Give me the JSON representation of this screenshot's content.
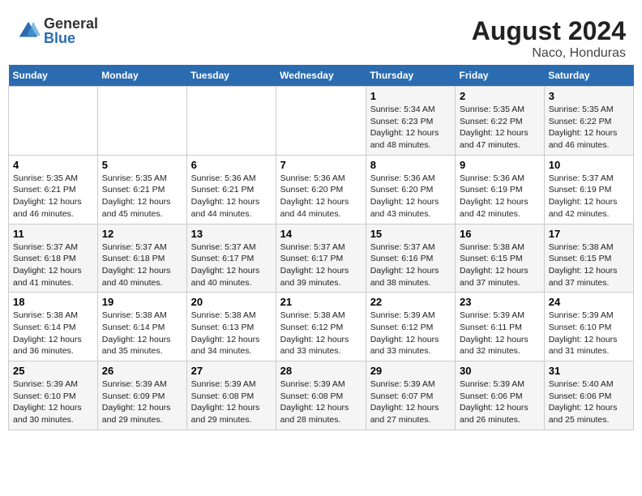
{
  "header": {
    "logo_general": "General",
    "logo_blue": "Blue",
    "title": "August 2024",
    "subtitle": "Naco, Honduras"
  },
  "calendar": {
    "days_of_week": [
      "Sunday",
      "Monday",
      "Tuesday",
      "Wednesday",
      "Thursday",
      "Friday",
      "Saturday"
    ],
    "weeks": [
      [
        {
          "day": "",
          "data": ""
        },
        {
          "day": "",
          "data": ""
        },
        {
          "day": "",
          "data": ""
        },
        {
          "day": "",
          "data": ""
        },
        {
          "day": "1",
          "data": "Sunrise: 5:34 AM\nSunset: 6:23 PM\nDaylight: 12 hours\nand 48 minutes."
        },
        {
          "day": "2",
          "data": "Sunrise: 5:35 AM\nSunset: 6:22 PM\nDaylight: 12 hours\nand 47 minutes."
        },
        {
          "day": "3",
          "data": "Sunrise: 5:35 AM\nSunset: 6:22 PM\nDaylight: 12 hours\nand 46 minutes."
        }
      ],
      [
        {
          "day": "4",
          "data": "Sunrise: 5:35 AM\nSunset: 6:21 PM\nDaylight: 12 hours\nand 46 minutes."
        },
        {
          "day": "5",
          "data": "Sunrise: 5:35 AM\nSunset: 6:21 PM\nDaylight: 12 hours\nand 45 minutes."
        },
        {
          "day": "6",
          "data": "Sunrise: 5:36 AM\nSunset: 6:21 PM\nDaylight: 12 hours\nand 44 minutes."
        },
        {
          "day": "7",
          "data": "Sunrise: 5:36 AM\nSunset: 6:20 PM\nDaylight: 12 hours\nand 44 minutes."
        },
        {
          "day": "8",
          "data": "Sunrise: 5:36 AM\nSunset: 6:20 PM\nDaylight: 12 hours\nand 43 minutes."
        },
        {
          "day": "9",
          "data": "Sunrise: 5:36 AM\nSunset: 6:19 PM\nDaylight: 12 hours\nand 42 minutes."
        },
        {
          "day": "10",
          "data": "Sunrise: 5:37 AM\nSunset: 6:19 PM\nDaylight: 12 hours\nand 42 minutes."
        }
      ],
      [
        {
          "day": "11",
          "data": "Sunrise: 5:37 AM\nSunset: 6:18 PM\nDaylight: 12 hours\nand 41 minutes."
        },
        {
          "day": "12",
          "data": "Sunrise: 5:37 AM\nSunset: 6:18 PM\nDaylight: 12 hours\nand 40 minutes."
        },
        {
          "day": "13",
          "data": "Sunrise: 5:37 AM\nSunset: 6:17 PM\nDaylight: 12 hours\nand 40 minutes."
        },
        {
          "day": "14",
          "data": "Sunrise: 5:37 AM\nSunset: 6:17 PM\nDaylight: 12 hours\nand 39 minutes."
        },
        {
          "day": "15",
          "data": "Sunrise: 5:37 AM\nSunset: 6:16 PM\nDaylight: 12 hours\nand 38 minutes."
        },
        {
          "day": "16",
          "data": "Sunrise: 5:38 AM\nSunset: 6:15 PM\nDaylight: 12 hours\nand 37 minutes."
        },
        {
          "day": "17",
          "data": "Sunrise: 5:38 AM\nSunset: 6:15 PM\nDaylight: 12 hours\nand 37 minutes."
        }
      ],
      [
        {
          "day": "18",
          "data": "Sunrise: 5:38 AM\nSunset: 6:14 PM\nDaylight: 12 hours\nand 36 minutes."
        },
        {
          "day": "19",
          "data": "Sunrise: 5:38 AM\nSunset: 6:14 PM\nDaylight: 12 hours\nand 35 minutes."
        },
        {
          "day": "20",
          "data": "Sunrise: 5:38 AM\nSunset: 6:13 PM\nDaylight: 12 hours\nand 34 minutes."
        },
        {
          "day": "21",
          "data": "Sunrise: 5:38 AM\nSunset: 6:12 PM\nDaylight: 12 hours\nand 33 minutes."
        },
        {
          "day": "22",
          "data": "Sunrise: 5:39 AM\nSunset: 6:12 PM\nDaylight: 12 hours\nand 33 minutes."
        },
        {
          "day": "23",
          "data": "Sunrise: 5:39 AM\nSunset: 6:11 PM\nDaylight: 12 hours\nand 32 minutes."
        },
        {
          "day": "24",
          "data": "Sunrise: 5:39 AM\nSunset: 6:10 PM\nDaylight: 12 hours\nand 31 minutes."
        }
      ],
      [
        {
          "day": "25",
          "data": "Sunrise: 5:39 AM\nSunset: 6:10 PM\nDaylight: 12 hours\nand 30 minutes."
        },
        {
          "day": "26",
          "data": "Sunrise: 5:39 AM\nSunset: 6:09 PM\nDaylight: 12 hours\nand 29 minutes."
        },
        {
          "day": "27",
          "data": "Sunrise: 5:39 AM\nSunset: 6:08 PM\nDaylight: 12 hours\nand 29 minutes."
        },
        {
          "day": "28",
          "data": "Sunrise: 5:39 AM\nSunset: 6:08 PM\nDaylight: 12 hours\nand 28 minutes."
        },
        {
          "day": "29",
          "data": "Sunrise: 5:39 AM\nSunset: 6:07 PM\nDaylight: 12 hours\nand 27 minutes."
        },
        {
          "day": "30",
          "data": "Sunrise: 5:39 AM\nSunset: 6:06 PM\nDaylight: 12 hours\nand 26 minutes."
        },
        {
          "day": "31",
          "data": "Sunrise: 5:40 AM\nSunset: 6:06 PM\nDaylight: 12 hours\nand 25 minutes."
        }
      ]
    ]
  }
}
